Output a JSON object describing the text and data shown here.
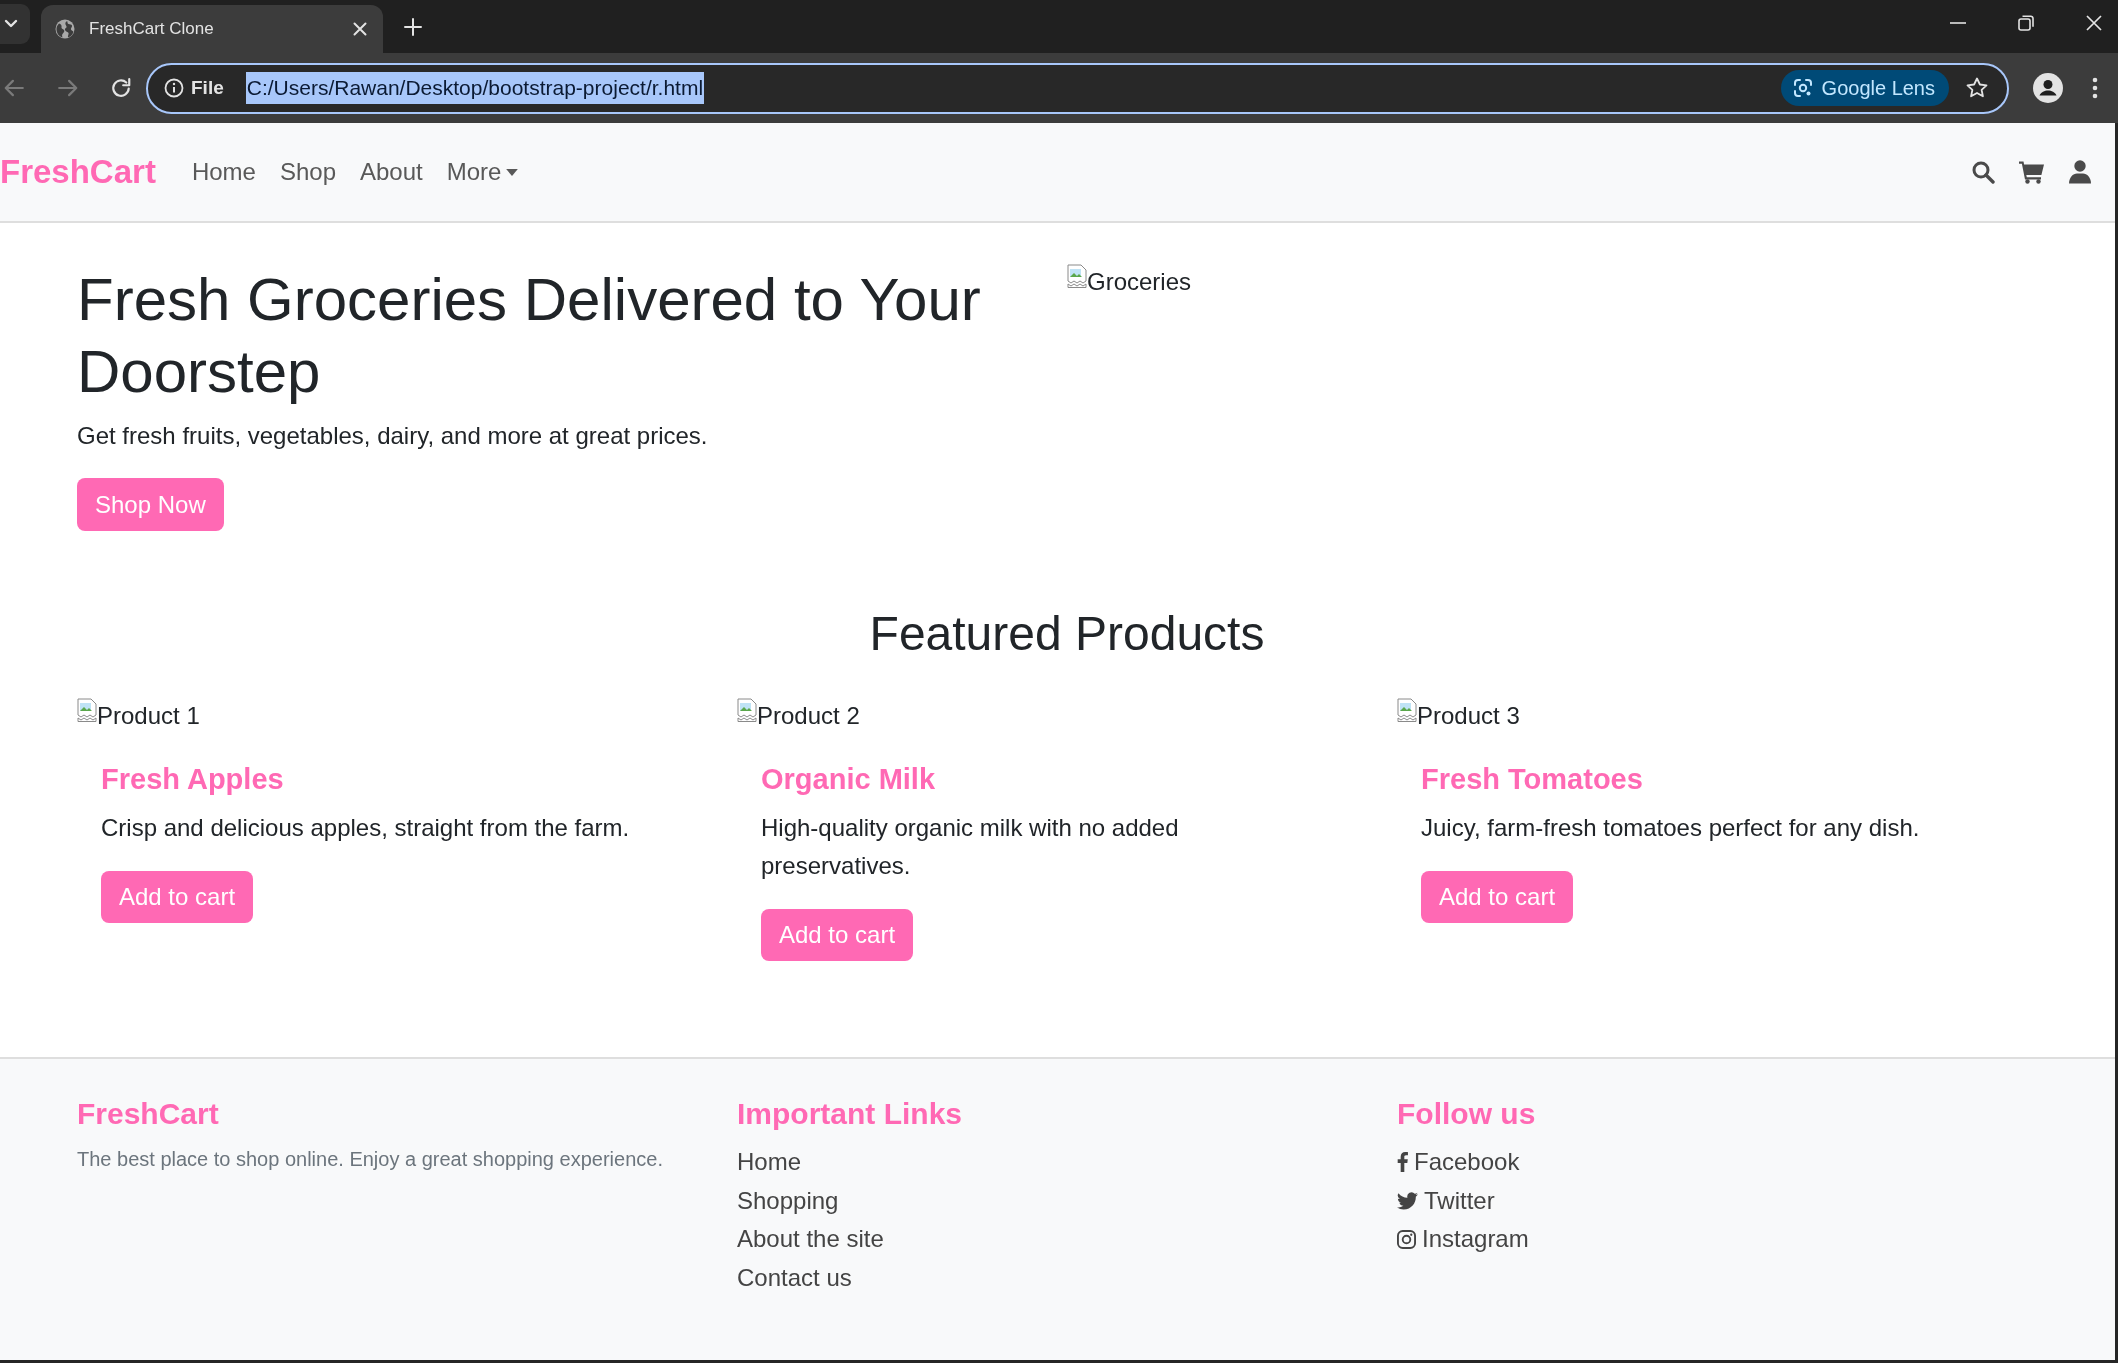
{
  "browser": {
    "tab": {
      "title": "FreshCart Clone",
      "selected": true
    },
    "nav_buttons": [
      {
        "kind": "back",
        "disabled": true
      },
      {
        "kind": "forward",
        "disabled": true
      },
      {
        "kind": "reload",
        "disabled": false
      }
    ],
    "address_bar": {
      "scheme_label": "File",
      "url": "C:/Users/Rawan/Desktop/bootstrap-project/r.html",
      "text_selected": true
    },
    "lens_button": "Google Lens"
  },
  "navbar": {
    "brand": "FreshCart",
    "links": [
      {
        "label": "Home",
        "dropdown": false
      },
      {
        "label": "Shop",
        "dropdown": false
      },
      {
        "label": "About",
        "dropdown": false
      },
      {
        "label": "More",
        "dropdown": true
      }
    ]
  },
  "hero": {
    "title": "Fresh Groceries Delivered to Your Doorstep",
    "text": "Get fresh fruits, vegetables, dairy, and more at great prices.",
    "button": "Shop Now",
    "image_alt": "Groceries"
  },
  "featured": {
    "title": "Featured Products",
    "products": [
      {
        "image_alt": "Product 1",
        "name": "Fresh Apples",
        "description": "Crisp and delicious apples, straight from the farm.",
        "button": "Add to cart"
      },
      {
        "image_alt": "Product 2",
        "name": "Organic Milk",
        "description": "High-quality organic milk with no added preservatives.",
        "button": "Add to cart"
      },
      {
        "image_alt": "Product 3",
        "name": "Fresh Tomatoes",
        "description": "Juicy, farm-fresh tomatoes perfect for any dish.",
        "button": "Add to cart"
      }
    ]
  },
  "footer": {
    "columns": [
      {
        "kind": "about",
        "title": "FreshCart",
        "text": "The best place to shop online. Enjoy a great shopping experience."
      },
      {
        "kind": "links",
        "title": "Important Links",
        "links": [
          "Home",
          "Shopping",
          "About the site",
          "Contact us"
        ]
      },
      {
        "kind": "social",
        "title": "Follow us",
        "links": [
          "Facebook",
          "Twitter",
          "Instagram"
        ]
      }
    ]
  }
}
